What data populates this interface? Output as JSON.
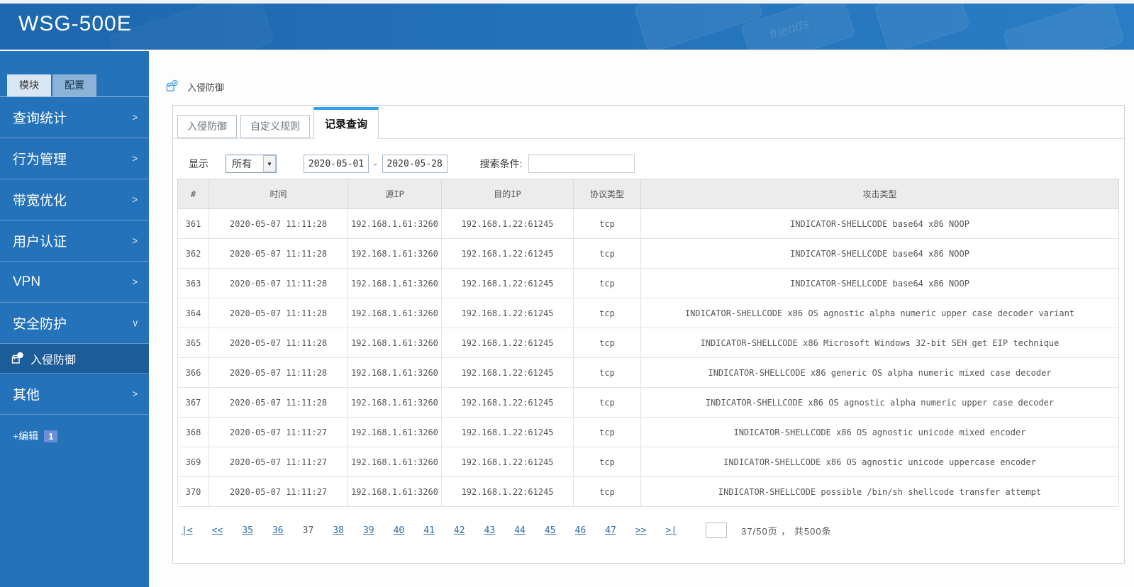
{
  "header": {
    "title": "WSG-500E",
    "decoration_text": "friends"
  },
  "sidebar": {
    "tabs": [
      {
        "label": "模块",
        "active": true
      },
      {
        "label": "配置",
        "active": false
      }
    ],
    "menu": [
      {
        "label": "查询统计",
        "arrow": ">",
        "type": "group"
      },
      {
        "label": "行为管理",
        "arrow": ">",
        "type": "group"
      },
      {
        "label": "带宽优化",
        "arrow": ">",
        "type": "group"
      },
      {
        "label": "用户认证",
        "arrow": ">",
        "type": "group"
      },
      {
        "label": "VPN",
        "arrow": ">",
        "type": "group"
      },
      {
        "label": "安全防护",
        "arrow": "v",
        "type": "group",
        "expanded": true
      },
      {
        "label": "入侵防御",
        "type": "subitem",
        "active": true,
        "icon": "intrusion-icon"
      },
      {
        "label": "其他",
        "arrow": ">",
        "type": "group"
      }
    ],
    "edit": {
      "label": "+编辑",
      "badge": "1"
    },
    "collapse_icon": "◀"
  },
  "breadcrumb": {
    "icon": "intrusion-icon",
    "label": "入侵防御"
  },
  "content": {
    "tabs": [
      {
        "label": "入侵防御",
        "active": false
      },
      {
        "label": "自定义规则",
        "active": false
      },
      {
        "label": "记录查询",
        "active": true
      }
    ],
    "filter": {
      "display_label": "显示",
      "display_value": "所有",
      "date_from": "2020-05-01",
      "date_separator": "-",
      "date_to": "2020-05-28",
      "search_label": "搜索条件:",
      "search_value": ""
    },
    "table": {
      "columns": [
        "#",
        "时间",
        "源IP",
        "目的IP",
        "协议类型",
        "攻击类型"
      ],
      "rows": [
        [
          "361",
          "2020-05-07 11:11:28",
          "192.168.1.61:3260",
          "192.168.1.22:61245",
          "tcp",
          "INDICATOR-SHELLCODE base64 x86 NOOP"
        ],
        [
          "362",
          "2020-05-07 11:11:28",
          "192.168.1.61:3260",
          "192.168.1.22:61245",
          "tcp",
          "INDICATOR-SHELLCODE base64 x86 NOOP"
        ],
        [
          "363",
          "2020-05-07 11:11:28",
          "192.168.1.61:3260",
          "192.168.1.22:61245",
          "tcp",
          "INDICATOR-SHELLCODE base64 x86 NOOP"
        ],
        [
          "364",
          "2020-05-07 11:11:28",
          "192.168.1.61:3260",
          "192.168.1.22:61245",
          "tcp",
          "INDICATOR-SHELLCODE x86 OS agnostic alpha numeric upper case decoder variant"
        ],
        [
          "365",
          "2020-05-07 11:11:28",
          "192.168.1.61:3260",
          "192.168.1.22:61245",
          "tcp",
          "INDICATOR-SHELLCODE x86 Microsoft Windows 32-bit SEH get EIP technique"
        ],
        [
          "366",
          "2020-05-07 11:11:28",
          "192.168.1.61:3260",
          "192.168.1.22:61245",
          "tcp",
          "INDICATOR-SHELLCODE x86 generic OS alpha numeric mixed case decoder"
        ],
        [
          "367",
          "2020-05-07 11:11:28",
          "192.168.1.61:3260",
          "192.168.1.22:61245",
          "tcp",
          "INDICATOR-SHELLCODE x86 OS agnostic alpha numeric upper case decoder"
        ],
        [
          "368",
          "2020-05-07 11:11:27",
          "192.168.1.61:3260",
          "192.168.1.22:61245",
          "tcp",
          "INDICATOR-SHELLCODE x86 OS agnostic unicode mixed encoder"
        ],
        [
          "369",
          "2020-05-07 11:11:27",
          "192.168.1.61:3260",
          "192.168.1.22:61245",
          "tcp",
          "INDICATOR-SHELLCODE x86 OS agnostic unicode uppercase encoder"
        ],
        [
          "370",
          "2020-05-07 11:11:27",
          "192.168.1.61:3260",
          "192.168.1.22:61245",
          "tcp",
          "INDICATOR-SHELLCODE possible /bin/sh shellcode transfer attempt"
        ]
      ]
    },
    "pagination": {
      "first_label": "|<",
      "prev_label": "<<",
      "pages": [
        "35",
        "36",
        "37",
        "38",
        "39",
        "40",
        "41",
        "42",
        "43",
        "44",
        "45",
        "46",
        "47"
      ],
      "current_page": "37",
      "next_label": ">>",
      "last_label": ">|",
      "page_input_value": "",
      "summary": "37/50页 ， 共500条"
    }
  }
}
